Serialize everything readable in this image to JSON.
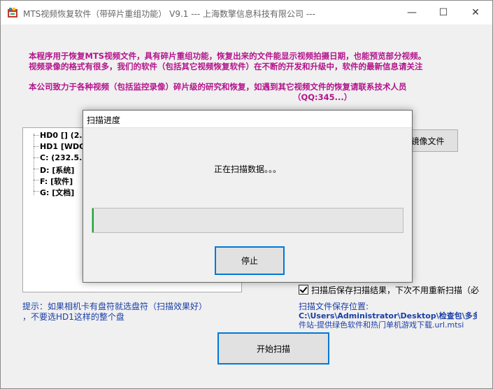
{
  "window": {
    "title": "MTS视频恢复软件（带碎片重组功能）  V9.1  ---  上海数擎信息科技有限公司  ---",
    "minimize_glyph": "—",
    "maximize_glyph": "☐",
    "close_glyph": "✕"
  },
  "intro": {
    "line1": "本程序用于恢复MTS视频文件，具有碎片重组功能，恢复出来的文件能显示视频拍摄日期，也能预览部分视频。",
    "line2": "视频录像的格式有很多，我们的软件（包括其它视频恢复软件）在不断的开发和升级中，软件的最新信息请关注",
    "line3": "本公司致力于各种视频（包括监控录像）碎片级的研究和恢复，如遇到其它视频文件的恢复请联系技术人员",
    "line4": "（QQ:345...）"
  },
  "drive_tree": {
    "items": [
      {
        "label": "HD0   [] (2..."
      },
      {
        "label": "HD1   [WDC..."
      },
      {
        "label": "C:    (232.5..."
      },
      {
        "label": "D:  [系统]"
      },
      {
        "label": "F:  [软件]"
      },
      {
        "label": "G:  [文档]"
      }
    ]
  },
  "buttons": {
    "image_file": "镜像文件",
    "start_scan": "开始扫描"
  },
  "options": {
    "save_after_scan_label": "扫描后保存扫描结果，下次不用重新扫描（必",
    "save_after_scan_checked": true
  },
  "hint": {
    "line1": "提示：如果相机卡有盘符就选盘符（扫描效果好）",
    "line2": "，不要选HD1这样的整个盘"
  },
  "save_location": {
    "label": "扫描文件保存位置:",
    "path1": "C:\\Users\\Administrator\\Desktop\\检查包\\多多",
    "path2": "件站-提供绿色软件和热门单机游戏下载.url.mtsi"
  },
  "dialog": {
    "title": "扫描进度",
    "status": "正在扫描数据。。。",
    "progress": 0.003,
    "stop": "停止"
  },
  "colors": {
    "intro_text": "#b4148c",
    "hint_text": "#1a3ea6",
    "progress_fill": "#06b025",
    "focus_border": "#0078d7"
  }
}
